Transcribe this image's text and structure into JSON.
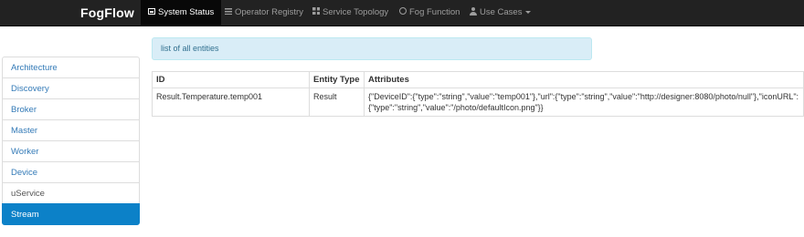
{
  "navbar": {
    "brand": "FogFlow",
    "items": [
      {
        "label": "System Status",
        "icon": "dashboard-icon",
        "active": true
      },
      {
        "label": "Operator Registry",
        "icon": "list-icon"
      },
      {
        "label": "Service Topology",
        "icon": "grid-icon"
      },
      {
        "label": "Fog Function",
        "icon": "clock-icon"
      },
      {
        "label": "Use Cases",
        "icon": "user-icon",
        "dropdown": true
      }
    ]
  },
  "sidebar": {
    "items": [
      {
        "label": "Architecture"
      },
      {
        "label": "Discovery"
      },
      {
        "label": "Broker"
      },
      {
        "label": "Master"
      },
      {
        "label": "Worker"
      },
      {
        "label": "Device"
      },
      {
        "label": "uService"
      },
      {
        "label": "Stream",
        "active": true
      }
    ]
  },
  "main": {
    "alert": "list of all entities",
    "table": {
      "headers": [
        "ID",
        "Entity Type",
        "Attributes"
      ],
      "rows": [
        {
          "id": "Result.Temperature.temp001",
          "entity_type": "Result",
          "attributes": "{\"DeviceID\":{\"type\":\"string\",\"value\":\"temp001\"},\"url\":{\"type\":\"string\",\"value\":\"http://designer:8080/photo/null\"},\"iconURL\":{\"type\":\"string\",\"value\":\"/photo/defaultIcon.png\"}}"
        }
      ]
    }
  },
  "colors": {
    "navbar_bg": "#222222",
    "active_accent": "#0c81c8",
    "alert_bg": "#d9edf7",
    "link": "#337ab7"
  }
}
